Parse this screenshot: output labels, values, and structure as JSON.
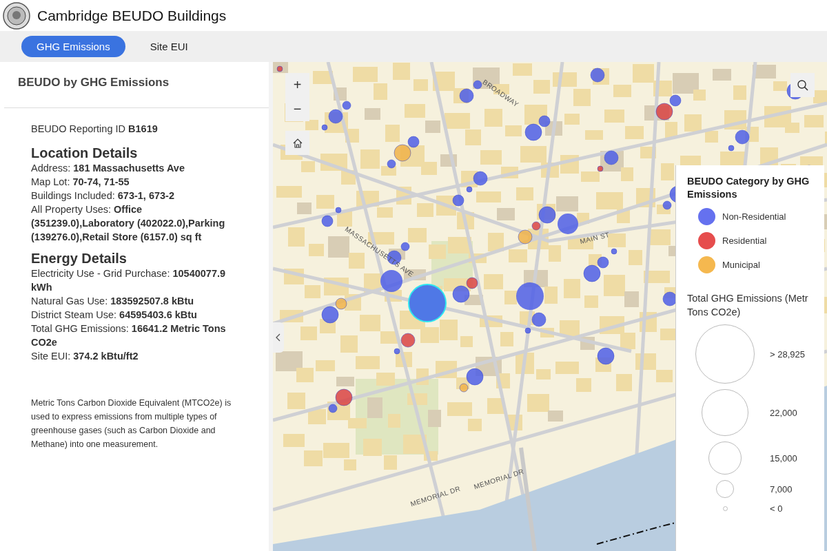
{
  "header": {
    "title": "Cambridge BEUDO Buildings"
  },
  "tabs": [
    {
      "label": "GHG Emissions",
      "selected": true
    },
    {
      "label": "Site EUI",
      "selected": false
    }
  ],
  "panel": {
    "title": "BEUDO by GHG Emissions",
    "reporting_id": "BEUDO Reporting ID **B1619**",
    "sections": [
      {
        "heading": "Location Details",
        "lines": [
          "Address: **181 Massachusetts Ave**",
          "Map Lot: **70-74, 71-55**",
          "Buildings Included: **673-1, 673-2**",
          "All Property Uses: **Office (351239.0),Laboratory (402022.0),Parking (139276.0),Retail Store (6157.0) sq ft**"
        ]
      },
      {
        "heading": "Energy Details",
        "lines": [
          "Electricity Use - Grid Purchase: **10540077.9 kWh**",
          "Natural Gas Use: **183592507.8 kBtu**",
          "District Steam Use: **64595403.6 kBtu**",
          "Total GHG Emissions: **16641.2 Metric Tons CO2e**",
          "Site EUI: **374.2 kBtu/ft2**"
        ]
      }
    ],
    "note": "Metric Tons Carbon Dioxide Equivalent (MTCO2e) is used to express emissions from multiple types of greenhouse gases (such as Carbon Dioxide and Methane) into one measurement."
  },
  "map": {
    "street_labels": [
      "BROADWAY",
      "MAIN ST",
      "MASSACHUSETTS AVE",
      "MEMORIAL DR",
      "MEMORIAL DR"
    ],
    "zoom_in": "+",
    "zoom_out": "−"
  },
  "legend": {
    "title": "BEUDO Category by GHG Emissions",
    "categories": [
      {
        "label": "Non-Residential",
        "color": "#6571ef"
      },
      {
        "label": "Residential",
        "color": "#e64d4d"
      },
      {
        "label": "Municipal",
        "color": "#f5b84f"
      }
    ],
    "size_title": [
      "Total GHG Emissions (Metr",
      "Tons CO2e)"
    ],
    "sizes": [
      "> 28,925",
      "22,000",
      "15,000",
      "7,000",
      "< 0"
    ]
  }
}
